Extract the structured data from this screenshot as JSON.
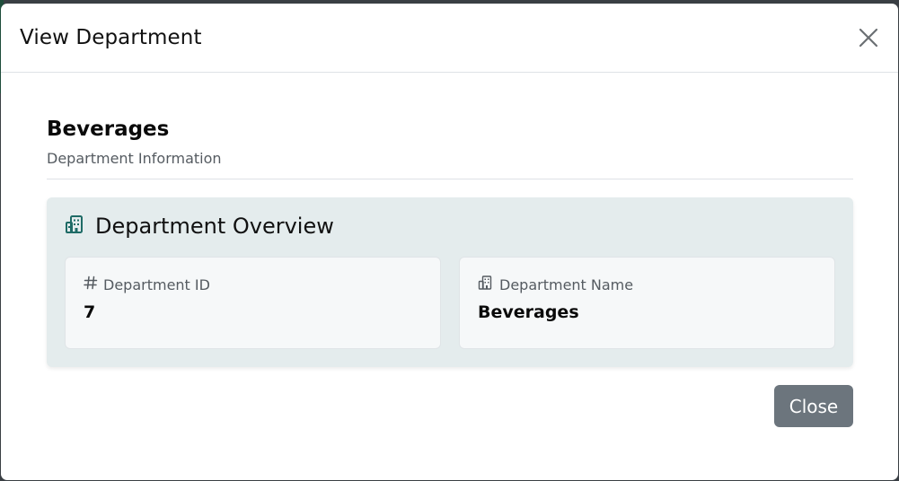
{
  "modal": {
    "title": "View Department",
    "close_icon": "close-icon"
  },
  "department": {
    "name": "Beverages",
    "subtitle": "Department Information"
  },
  "overview": {
    "title": "Department Overview",
    "icon": "building-icon",
    "accent_color": "#1e6b66",
    "fields": [
      {
        "label": "Department ID",
        "value": "7",
        "icon": "hash-icon"
      },
      {
        "label": "Department Name",
        "value": "Beverages",
        "icon": "building-icon"
      }
    ]
  },
  "footer": {
    "close_label": "Close",
    "close_color": "#6c757d"
  }
}
